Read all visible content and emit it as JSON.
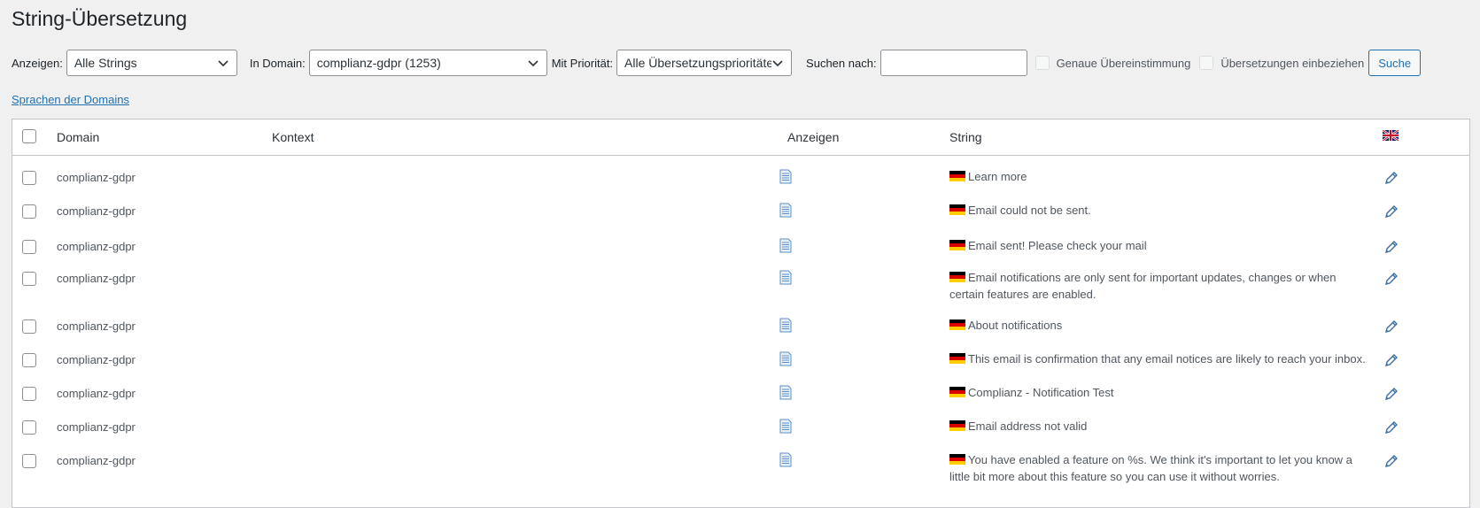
{
  "page": {
    "title": "String-Übersetzung"
  },
  "filters": {
    "show_label": "Anzeigen:",
    "show_value": "Alle Strings",
    "domain_label": "In Domain:",
    "domain_value": "complianz-gdpr (1253)",
    "priority_label": "Mit Priorität:",
    "priority_value": "Alle Übersetzungsprioritäten",
    "search_label": "Suchen nach:",
    "search_value": "",
    "exact_match_label": "Genaue Übereinstimmung",
    "include_translations_label": "Übersetzungen einbeziehen",
    "search_button": "Suche"
  },
  "domain_languages_link": "Sprachen der Domains",
  "table": {
    "headers": {
      "domain": "Domain",
      "context": "Kontext",
      "view": "Anzeigen",
      "string": "String"
    },
    "rows": [
      {
        "domain": "complianz-gdpr",
        "context": "",
        "string": "Learn more"
      },
      {
        "domain": "complianz-gdpr",
        "context": "",
        "string": "Email could not be sent."
      },
      {
        "domain": "complianz-gdpr",
        "context": "",
        "string": "Email sent! Please check your mail"
      },
      {
        "domain": "complianz-gdpr",
        "context": "",
        "string": "Email notifications are only sent for important updates, changes or when certain features are enabled."
      },
      {
        "domain": "complianz-gdpr",
        "context": "",
        "string": "About notifications"
      },
      {
        "domain": "complianz-gdpr",
        "context": "",
        "string": "This email is confirmation that any email notices are likely to reach your inbox."
      },
      {
        "domain": "complianz-gdpr",
        "context": "",
        "string": "Complianz - Notification Test"
      },
      {
        "domain": "complianz-gdpr",
        "context": "",
        "string": "Email address not valid"
      },
      {
        "domain": "complianz-gdpr",
        "context": "",
        "string": "You have enabled a feature on %s. We think it's important to let you know a little bit more about this feature so you can use it without worries."
      }
    ]
  },
  "icons": {
    "view": "document-icon",
    "edit": "pencil-icon",
    "header_language": "uk-flag-icon",
    "row_language": "german-flag-icon"
  },
  "colors": {
    "accent": "#2271b1",
    "background": "#f0f0f1"
  }
}
